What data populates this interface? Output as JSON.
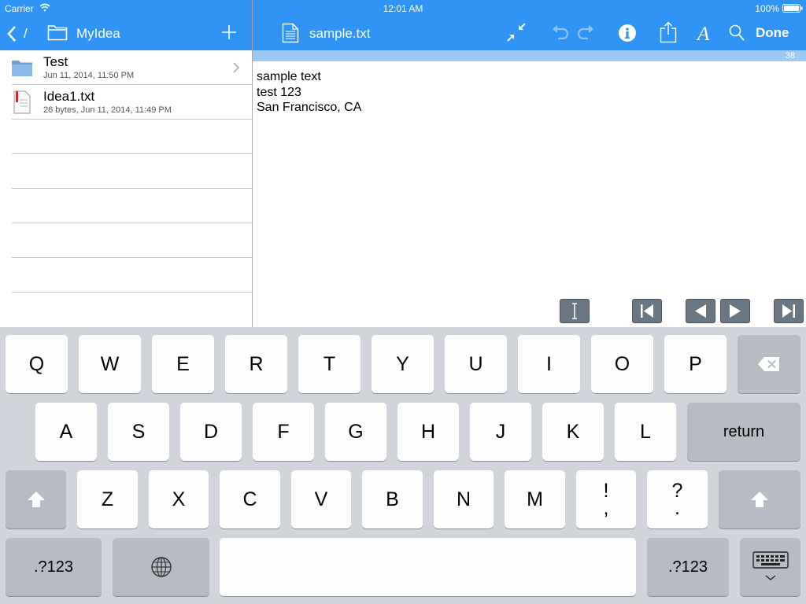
{
  "status_bar": {
    "carrier": "Carrier",
    "time": "12:01 AM",
    "battery": "100%"
  },
  "left_nav": {
    "back_path": "/",
    "folder_title": "MyIdea",
    "icons": [
      "back-chevron-icon",
      "folder-icon",
      "add-icon"
    ]
  },
  "editor_toolbar": {
    "document_title": "sample.txt",
    "done_label": "Done",
    "icons": [
      "document-icon",
      "collapse-icon",
      "undo-icon",
      "redo-icon",
      "info-icon",
      "share-icon",
      "font-icon",
      "search-icon"
    ]
  },
  "file_list": {
    "items": [
      {
        "name": "Test",
        "meta": "Jun 11, 2014, 11:50 PM",
        "type": "folder"
      },
      {
        "name": "Idea1.txt",
        "meta": "26 bytes, Jun 11, 2014, 11:49 PM",
        "type": "text-file"
      }
    ]
  },
  "editor": {
    "character_count": "38",
    "lines": [
      "sample text",
      "test 123",
      "San Francisco, CA"
    ],
    "bottom_buttons": [
      "cursor-icon",
      "first-page-icon",
      "previous-icon",
      "next-icon",
      "last-page-icon"
    ]
  },
  "keyboard": {
    "row1": [
      "Q",
      "W",
      "E",
      "R",
      "T",
      "Y",
      "U",
      "I",
      "O",
      "P"
    ],
    "row2": [
      "A",
      "S",
      "D",
      "F",
      "G",
      "H",
      "J",
      "K",
      "L"
    ],
    "row3": [
      "Z",
      "X",
      "C",
      "V",
      "B",
      "N",
      "M"
    ],
    "punct1": {
      "top": "!",
      "bottom": ","
    },
    "punct2": {
      "top": "?",
      "bottom": "."
    },
    "return_label": "return",
    "numbers_label_left": ".?123",
    "numbers_label_right": ".?123",
    "colors": {
      "background": "#d1d5db",
      "key": "#fdfdfd",
      "dark_key": "#b7bcc4"
    }
  },
  "colors": {
    "toolbar_blue": "#2f94f6",
    "ruler_blue": "#9ccaf6",
    "button_gray": "#6b7683"
  }
}
